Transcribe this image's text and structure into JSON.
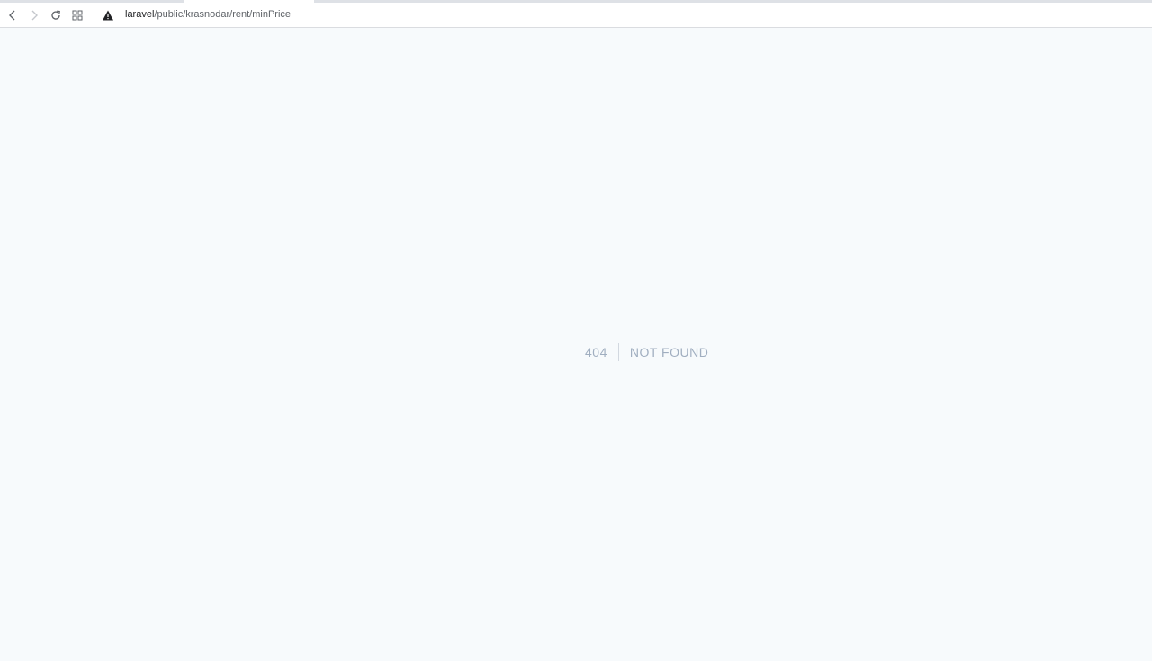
{
  "browser": {
    "url_host": "laravel",
    "url_path": "/public/krasnodar/rent/minPrice",
    "icons": {
      "back": "back-arrow-icon",
      "forward": "forward-arrow-icon",
      "reload": "reload-icon",
      "apps": "apps-grid-icon",
      "security": "warning-triangle-icon"
    }
  },
  "error": {
    "code": "404",
    "message": "NOT FOUND"
  }
}
